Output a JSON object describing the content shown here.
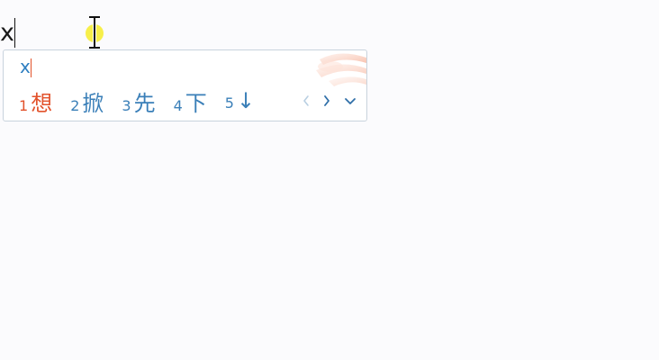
{
  "document": {
    "text": "x"
  },
  "ime": {
    "composition": "x",
    "candidates": [
      {
        "index": "1",
        "text": "想",
        "selected": true
      },
      {
        "index": "2",
        "text": "掀",
        "selected": false
      },
      {
        "index": "3",
        "text": "先",
        "selected": false
      },
      {
        "index": "4",
        "text": "下",
        "selected": false
      },
      {
        "index": "5",
        "text": "↓",
        "selected": false
      }
    ],
    "nav": {
      "prev_icon": "chevron-left-icon",
      "next_icon": "chevron-right-icon",
      "expand_icon": "chevron-down-icon"
    }
  },
  "colors": {
    "selected_candidate": "#e2522b",
    "candidate": "#3a7fb8",
    "composition": "#2f7fc1",
    "mouse_highlight": "#f6ec2a"
  }
}
